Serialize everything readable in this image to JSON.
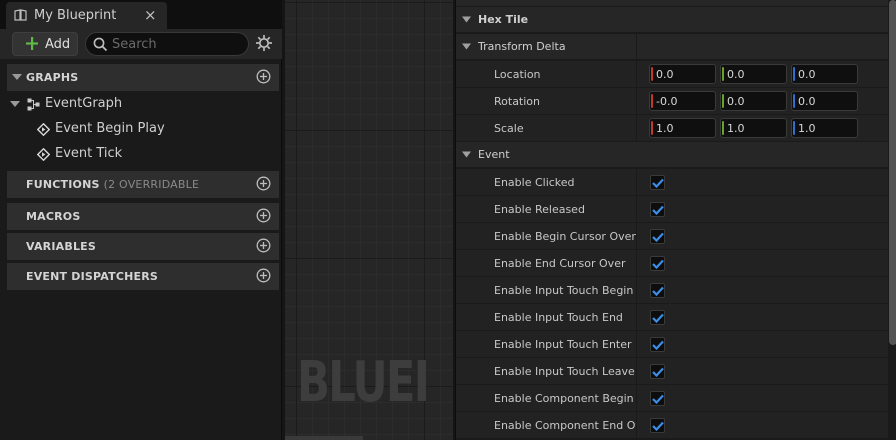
{
  "tab": {
    "title": "My Blueprint",
    "close": "×"
  },
  "toolbar": {
    "add_label": "Add",
    "search_placeholder": "Search"
  },
  "sections": {
    "graphs": "GRAPHS",
    "functions": "FUNCTIONS",
    "functions_note": "(2 OVERRIDABLE",
    "macros": "MACROS",
    "variables": "VARIABLES",
    "dispatchers": "EVENT DISPATCHERS"
  },
  "tree": {
    "event_graph": "EventGraph",
    "events": [
      "Event Begin Play",
      "Event Tick"
    ]
  },
  "graph": {
    "watermark": "BLUEI"
  },
  "details": {
    "hex_tile": "Hex Tile",
    "transform": {
      "label": "Transform Delta",
      "rows": [
        {
          "label": "Location",
          "x": "0.0",
          "y": "0.0",
          "z": "0.0"
        },
        {
          "label": "Rotation",
          "x": "-0.0",
          "y": "0.0",
          "z": "0.0"
        },
        {
          "label": "Scale",
          "x": "1.0",
          "y": "1.0",
          "z": "1.0"
        }
      ]
    },
    "event": {
      "label": "Event",
      "rows": [
        {
          "label": "Enable Clicked",
          "checked": true
        },
        {
          "label": "Enable Released",
          "checked": true
        },
        {
          "label": "Enable Begin Cursor Over",
          "checked": true
        },
        {
          "label": "Enable End Cursor Over",
          "checked": true
        },
        {
          "label": "Enable Input Touch Begin",
          "checked": true
        },
        {
          "label": "Enable Input Touch End",
          "checked": true
        },
        {
          "label": "Enable Input Touch Enter",
          "checked": true
        },
        {
          "label": "Enable Input Touch Leave",
          "checked": true
        },
        {
          "label": "Enable Component Begin O...",
          "checked": true
        },
        {
          "label": "Enable Component End Ov...",
          "checked": true
        }
      ]
    }
  },
  "colors": {
    "x_axis": "#c0392b",
    "y_axis": "#6aa32a",
    "z_axis": "#2f6fd1",
    "accent": "#3b8ee8",
    "plus": "#5fb848"
  }
}
